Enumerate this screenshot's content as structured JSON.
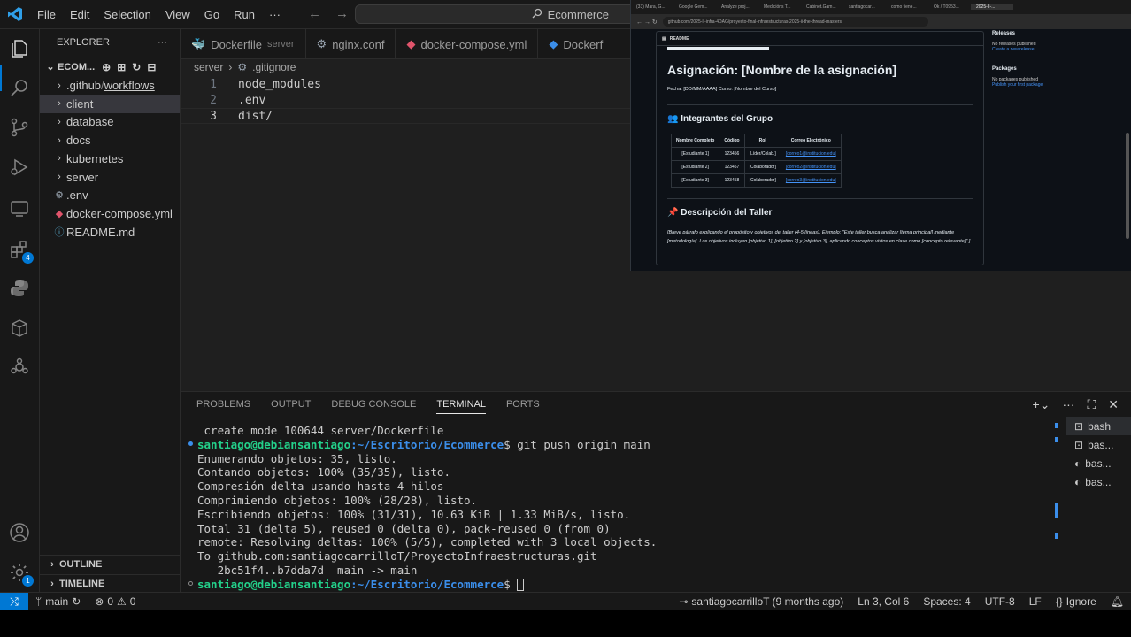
{
  "menu": [
    "File",
    "Edit",
    "Selection",
    "View",
    "Go",
    "Run",
    "···"
  ],
  "search": {
    "text": "Ecommerce"
  },
  "explorer": {
    "title": "EXPLORER",
    "root": "ECOM...",
    "items": [
      {
        "label": ".github",
        "extra": "workflows",
        "type": "folder"
      },
      {
        "label": "client",
        "type": "folder",
        "selected": true
      },
      {
        "label": "database",
        "type": "folder"
      },
      {
        "label": "docs",
        "type": "folder"
      },
      {
        "label": "kubernetes",
        "type": "folder"
      },
      {
        "label": "server",
        "type": "folder"
      },
      {
        "label": ".env",
        "type": "env"
      },
      {
        "label": "docker-compose.yml",
        "type": "yml"
      },
      {
        "label": "README.md",
        "type": "md"
      }
    ],
    "outline": "OUTLINE",
    "timeline": "TIMELINE"
  },
  "tabs": [
    {
      "label": "Dockerfile",
      "desc": "server"
    },
    {
      "label": "nginx.conf",
      "desc": ""
    },
    {
      "label": "docker-compose.yml",
      "desc": ""
    },
    {
      "label": "Dockerf",
      "desc": ""
    }
  ],
  "breadcrumb": {
    "folder": "server",
    "file": ".gitignore"
  },
  "code": [
    {
      "n": "1",
      "t": "node_modules"
    },
    {
      "n": "2",
      "t": ".env"
    },
    {
      "n": "3",
      "t": "dist/"
    }
  ],
  "browser": {
    "tabs": [
      "(33) Mara, G...",
      "Google Gem...",
      "Analyze proj...",
      "Medicións T...",
      "Cabinet.Gam...",
      "santiagocar...",
      "como tiene...",
      "Ok / T0953...",
      "2025-II-..."
    ],
    "url": "github.com/2025-II-infra-4DAG/proyecto-final-infraestructuras-2025-ii-the-thread-masters",
    "readme_label": "README",
    "title": "Asignación: [Nombre de la asignación]",
    "fecha": "Fecha: [DD/MM/AAAA] Curso: [Nombre del Curso]",
    "group_heading": "👥 Integrantes del Grupo",
    "table_head": [
      "Nombre Completo",
      "Código",
      "Rol",
      "Correo Electrónico"
    ],
    "table_rows": [
      [
        "[Estudiante 1]",
        "123456",
        "[Líder/Colab.]",
        "[correo1@institucion.edu]"
      ],
      [
        "[Estudiante 2]",
        "123457",
        "[Colaborador]",
        "[correo2@institucion.edu]"
      ],
      [
        "[Estudiante 3]",
        "123458",
        "[Colaborador]",
        "[correo3@institucion.edu]"
      ]
    ],
    "desc_heading": "📌 Descripción del Taller",
    "desc_text": "[Breve párrafo explicando el propósito y objetivos del taller (4-5 líneas). Ejemplo: \"Este taller busca analizar [tema principal] mediante [metodología]. Los objetivos incluyen [objetivo 1], [objetivo 2] y [objetivo 3], aplicando conceptos vistos en clase como [concepto relevante]\".]",
    "side": {
      "releases": "Releases",
      "releases_text": "No releases published",
      "releases_link": "Create a new release",
      "packages": "Packages",
      "packages_text": "No packages published",
      "packages_link": "Publish your first package"
    }
  },
  "panel": {
    "tabs": [
      "PROBLEMS",
      "OUTPUT",
      "DEBUG CONSOLE",
      "TERMINAL",
      "PORTS"
    ],
    "active": "TERMINAL"
  },
  "terminal": {
    "l0": " create mode 100644 server/Dockerfile",
    "user": "santiago@debiansantiago",
    "path": ":~/Escritorio/Ecommerce",
    "cmd": "$ git push origin main",
    "out": [
      "Enumerando objetos: 35, listo.",
      "Contando objetos: 100% (35/35), listo.",
      "Compresión delta usando hasta 4 hilos",
      "Comprimiendo objetos: 100% (28/28), listo.",
      "Escribiendo objetos: 100% (31/31), 10.63 KiB | 1.33 MiB/s, listo.",
      "Total 31 (delta 5), reused 0 (delta 0), pack-reused 0 (from 0)",
      "remote: Resolving deltas: 100% (5/5), completed with 3 local objects.",
      "To github.com:santiagocarrilloT/ProyectoInfraestructuras.git",
      "   2bc51f4..b7dda7d  main -> main"
    ],
    "prompt_end": "$ ",
    "list": [
      "bash",
      "bas...",
      "bas...",
      "bas..."
    ]
  },
  "status": {
    "branch": "main",
    "problems": "0",
    "warnings": "0",
    "blame": "santiagocarrilloT (9 months ago)",
    "position": "Ln 3, Col 6",
    "spaces": "Spaces: 4",
    "encoding": "UTF-8",
    "eol": "LF",
    "language": "Ignore"
  },
  "colors": {
    "accent": "#0078d4",
    "prompt_user": "#23d18b",
    "prompt_path": "#3b8eea"
  },
  "activity": {
    "extensions_badge": "4",
    "accounts_badge": "1"
  }
}
